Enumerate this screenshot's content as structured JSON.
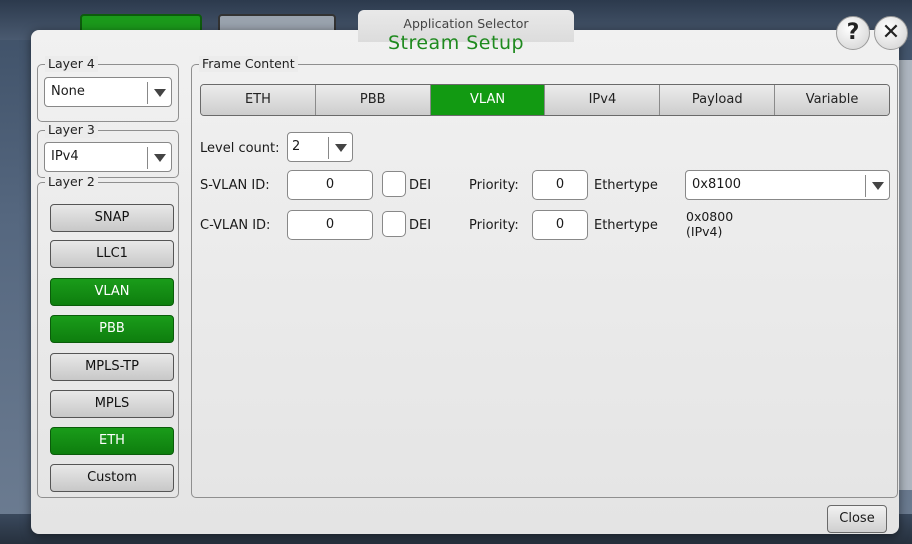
{
  "app_selector": "Application Selector",
  "dialog_title": "Stream Setup",
  "help_label": "?",
  "close_icon_label": "✕",
  "layer4": {
    "legend": "Layer 4",
    "value": "None"
  },
  "layer3": {
    "legend": "Layer 3",
    "value": "IPv4"
  },
  "layer2": {
    "legend": "Layer 2",
    "buttons": [
      {
        "label": "SNAP",
        "active": false
      },
      {
        "label": "LLC1",
        "active": false
      },
      {
        "label": "VLAN",
        "active": true
      },
      {
        "label": "PBB",
        "active": true
      },
      {
        "label": "MPLS-TP",
        "active": false
      },
      {
        "label": "MPLS",
        "active": false
      },
      {
        "label": "ETH",
        "active": true
      },
      {
        "label": "Custom",
        "active": false
      }
    ]
  },
  "frame_content": {
    "legend": "Frame Content",
    "tabs": [
      "ETH",
      "PBB",
      "VLAN",
      "IPv4",
      "Payload",
      "Variable"
    ],
    "active_tab": "VLAN",
    "level_count_label": "Level count:",
    "level_count_value": "2",
    "svlan": {
      "label": "S-VLAN ID:",
      "id": "0",
      "dei_label": "DEI",
      "priority_label": "Priority:",
      "priority": "0",
      "ethertype_label": "Ethertype",
      "ethertype": "0x8100"
    },
    "cvlan": {
      "label": "C-VLAN ID:",
      "id": "0",
      "dei_label": "DEI",
      "priority_label": "Priority:",
      "priority": "0",
      "ethertype_label": "Ethertype",
      "ethertype_line1": "0x0800",
      "ethertype_line2": "(IPv4)"
    }
  },
  "close_button": "Close",
  "colors": {
    "active_green": "#129a12",
    "title_green": "#1f8a1f"
  }
}
